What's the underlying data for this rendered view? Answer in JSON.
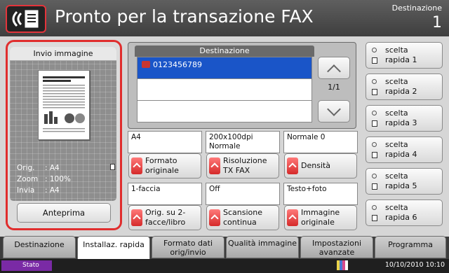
{
  "header": {
    "title": "Pronto per la transazione FAX",
    "destination_label": "Destinazione",
    "destination_count": "1"
  },
  "preview_panel": {
    "title": "Invio immagine",
    "info": [
      {
        "key": "Orig.",
        "value": ": A4"
      },
      {
        "key": "Zoom",
        "value": ": 100%"
      },
      {
        "key": "Invia",
        "value": ": A4"
      }
    ],
    "preview_button": "Anteprima"
  },
  "destination": {
    "header": "Destinazione",
    "rows": [
      "0123456789",
      "",
      ""
    ],
    "page_indicator": "1/1"
  },
  "quick_dial": [
    {
      "line1": "scelta",
      "line2": "rapida 1"
    },
    {
      "line1": "scelta",
      "line2": "rapida 2"
    },
    {
      "line1": "scelta",
      "line2": "rapida 3"
    },
    {
      "line1": "scelta",
      "line2": "rapida 4"
    },
    {
      "line1": "scelta",
      "line2": "rapida 5"
    },
    {
      "line1": "scelta",
      "line2": "rapida 6"
    }
  ],
  "settings": {
    "row1": [
      {
        "value": "A4",
        "button": "Formato originale"
      },
      {
        "value": "200x100dpi Normale",
        "button": "Risoluzione TX FAX"
      },
      {
        "value": "Normale 0",
        "button": "Densità"
      }
    ],
    "row2": [
      {
        "value": "1-faccia",
        "button": "Orig. su 2-facce/libro"
      },
      {
        "value": "Off",
        "button": "Scansione continua"
      },
      {
        "value": "Testo+foto",
        "button": "Immagine originale"
      }
    ]
  },
  "tabs": [
    {
      "label": "Destinazione"
    },
    {
      "label": "Installaz. rapida",
      "active": true
    },
    {
      "label": "Formato dati orig/invio"
    },
    {
      "label": "Qualità immagine"
    },
    {
      "label": "Impostazioni avanzate"
    },
    {
      "label": "Programma"
    }
  ],
  "status": {
    "label": "Stato",
    "datetime": "10/10/2010  10:10"
  },
  "colors": {
    "accent_red": "#e02d2d",
    "selection_blue": "#1a55c8",
    "status_purple": "#7a2aa5"
  }
}
